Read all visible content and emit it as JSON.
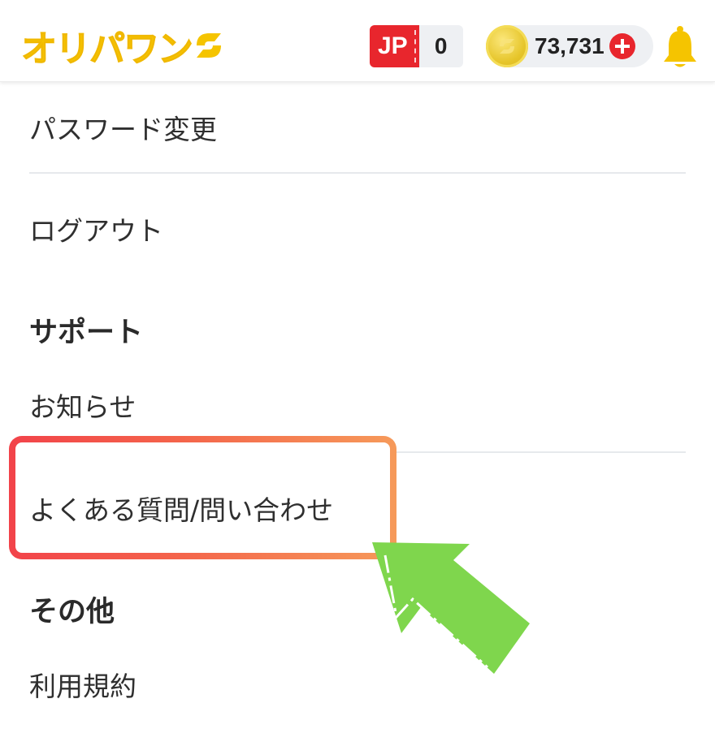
{
  "header": {
    "logo_text": "オリパワン",
    "jp_badge": {
      "label": "JP",
      "count": "0"
    },
    "coins": {
      "value": "73,731"
    }
  },
  "menu": {
    "password_change": "パスワード変更",
    "logout": "ログアウト",
    "support_title": "サポート",
    "news": "お知らせ",
    "faq_contact": "よくある質問/問い合わせ",
    "other_title": "その他",
    "terms": "利用規約"
  },
  "colors": {
    "brand_yellow": "#f5c400",
    "jp_red": "#e8262d",
    "highlight_start": "#f2434a",
    "highlight_end": "#f69a5a",
    "arrow_green": "#7fd64d"
  },
  "icons": {
    "logo_mark": "logo-mark-icon",
    "coin": "coin-icon",
    "plus": "plus-icon",
    "bell": "bell-icon",
    "arrow": "pointer-arrow-icon"
  }
}
